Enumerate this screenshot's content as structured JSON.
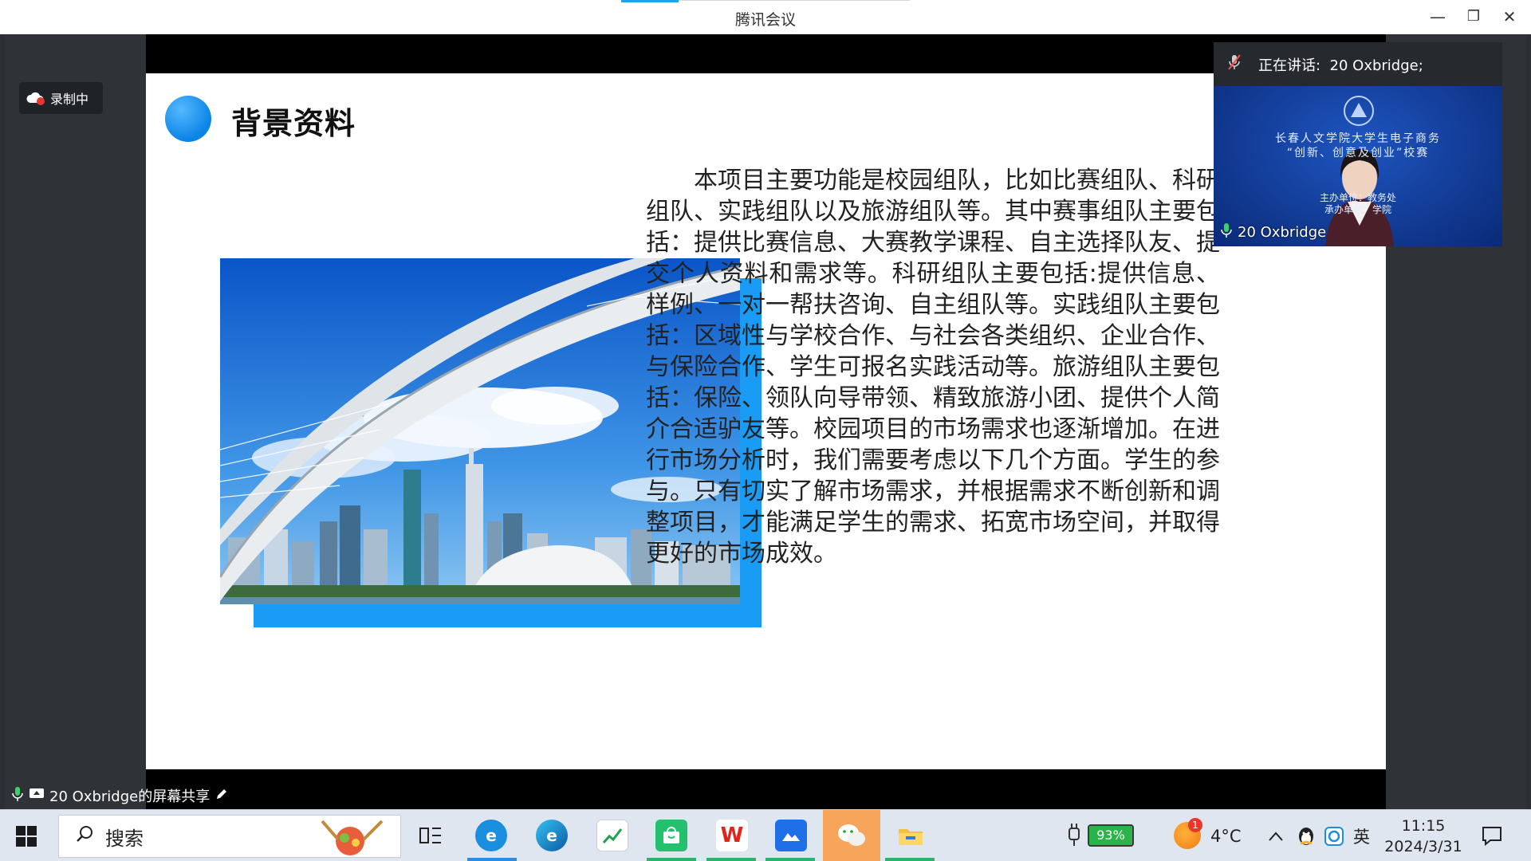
{
  "window": {
    "title": "腾讯会议",
    "minimize": "—",
    "restore": "❐",
    "close": "✕"
  },
  "recording": {
    "label": "录制中"
  },
  "slide": {
    "heading": "背景资料",
    "paragraph": "本项目主要功能是校园组队，比如比赛组队、科研组队、实践组队以及旅游组队等。其中赛事组队主要包括：提供比赛信息、大赛教学课程、自主选择队友、提交个人资料和需求等。科研组队主要包括:提供信息、样例、一对一帮扶咨询、自主组队等。实践组队主要包括：区域性与学校合作、与社会各类组织、企业合作、与保险合作、学生可报名实践活动等。旅游组队主要包括：保险、领队向导带领、精致旅游小团、提供个人简介合适驴友等。校园项目的市场需求也逐渐增加。在进行市场分析时，我们需要考虑以下几个方面。学生的参与。只有切实了解市场需求，并根据需求不断创新和调整项目，才能满足学生的需求、拓宽市场空间，并取得更好的市场成效。"
  },
  "speaker": {
    "header_label": "正在讲话:",
    "header_name": "20 Oxbridge;",
    "tile_name": "20 Oxbridge",
    "backdrop_line1": "长春人文学院大学生电子商务",
    "backdrop_line2": "“创新、创意及创业”校赛",
    "backdrop_line3": "主办单位：教务处",
    "backdrop_line4": "承办单位：学院"
  },
  "share": {
    "label": "20 Oxbridge的屏幕共享"
  },
  "taskbar": {
    "search_placeholder": "搜索",
    "battery": "93%",
    "weather": "4°C",
    "ime": "英",
    "time": "11:15",
    "date": "2024/3/31",
    "notification_count": "1"
  },
  "colors": {
    "accent_blue": "#1a9bf5",
    "taskbar": "#dfe6ef",
    "wechat_green": "#2fb26b"
  }
}
